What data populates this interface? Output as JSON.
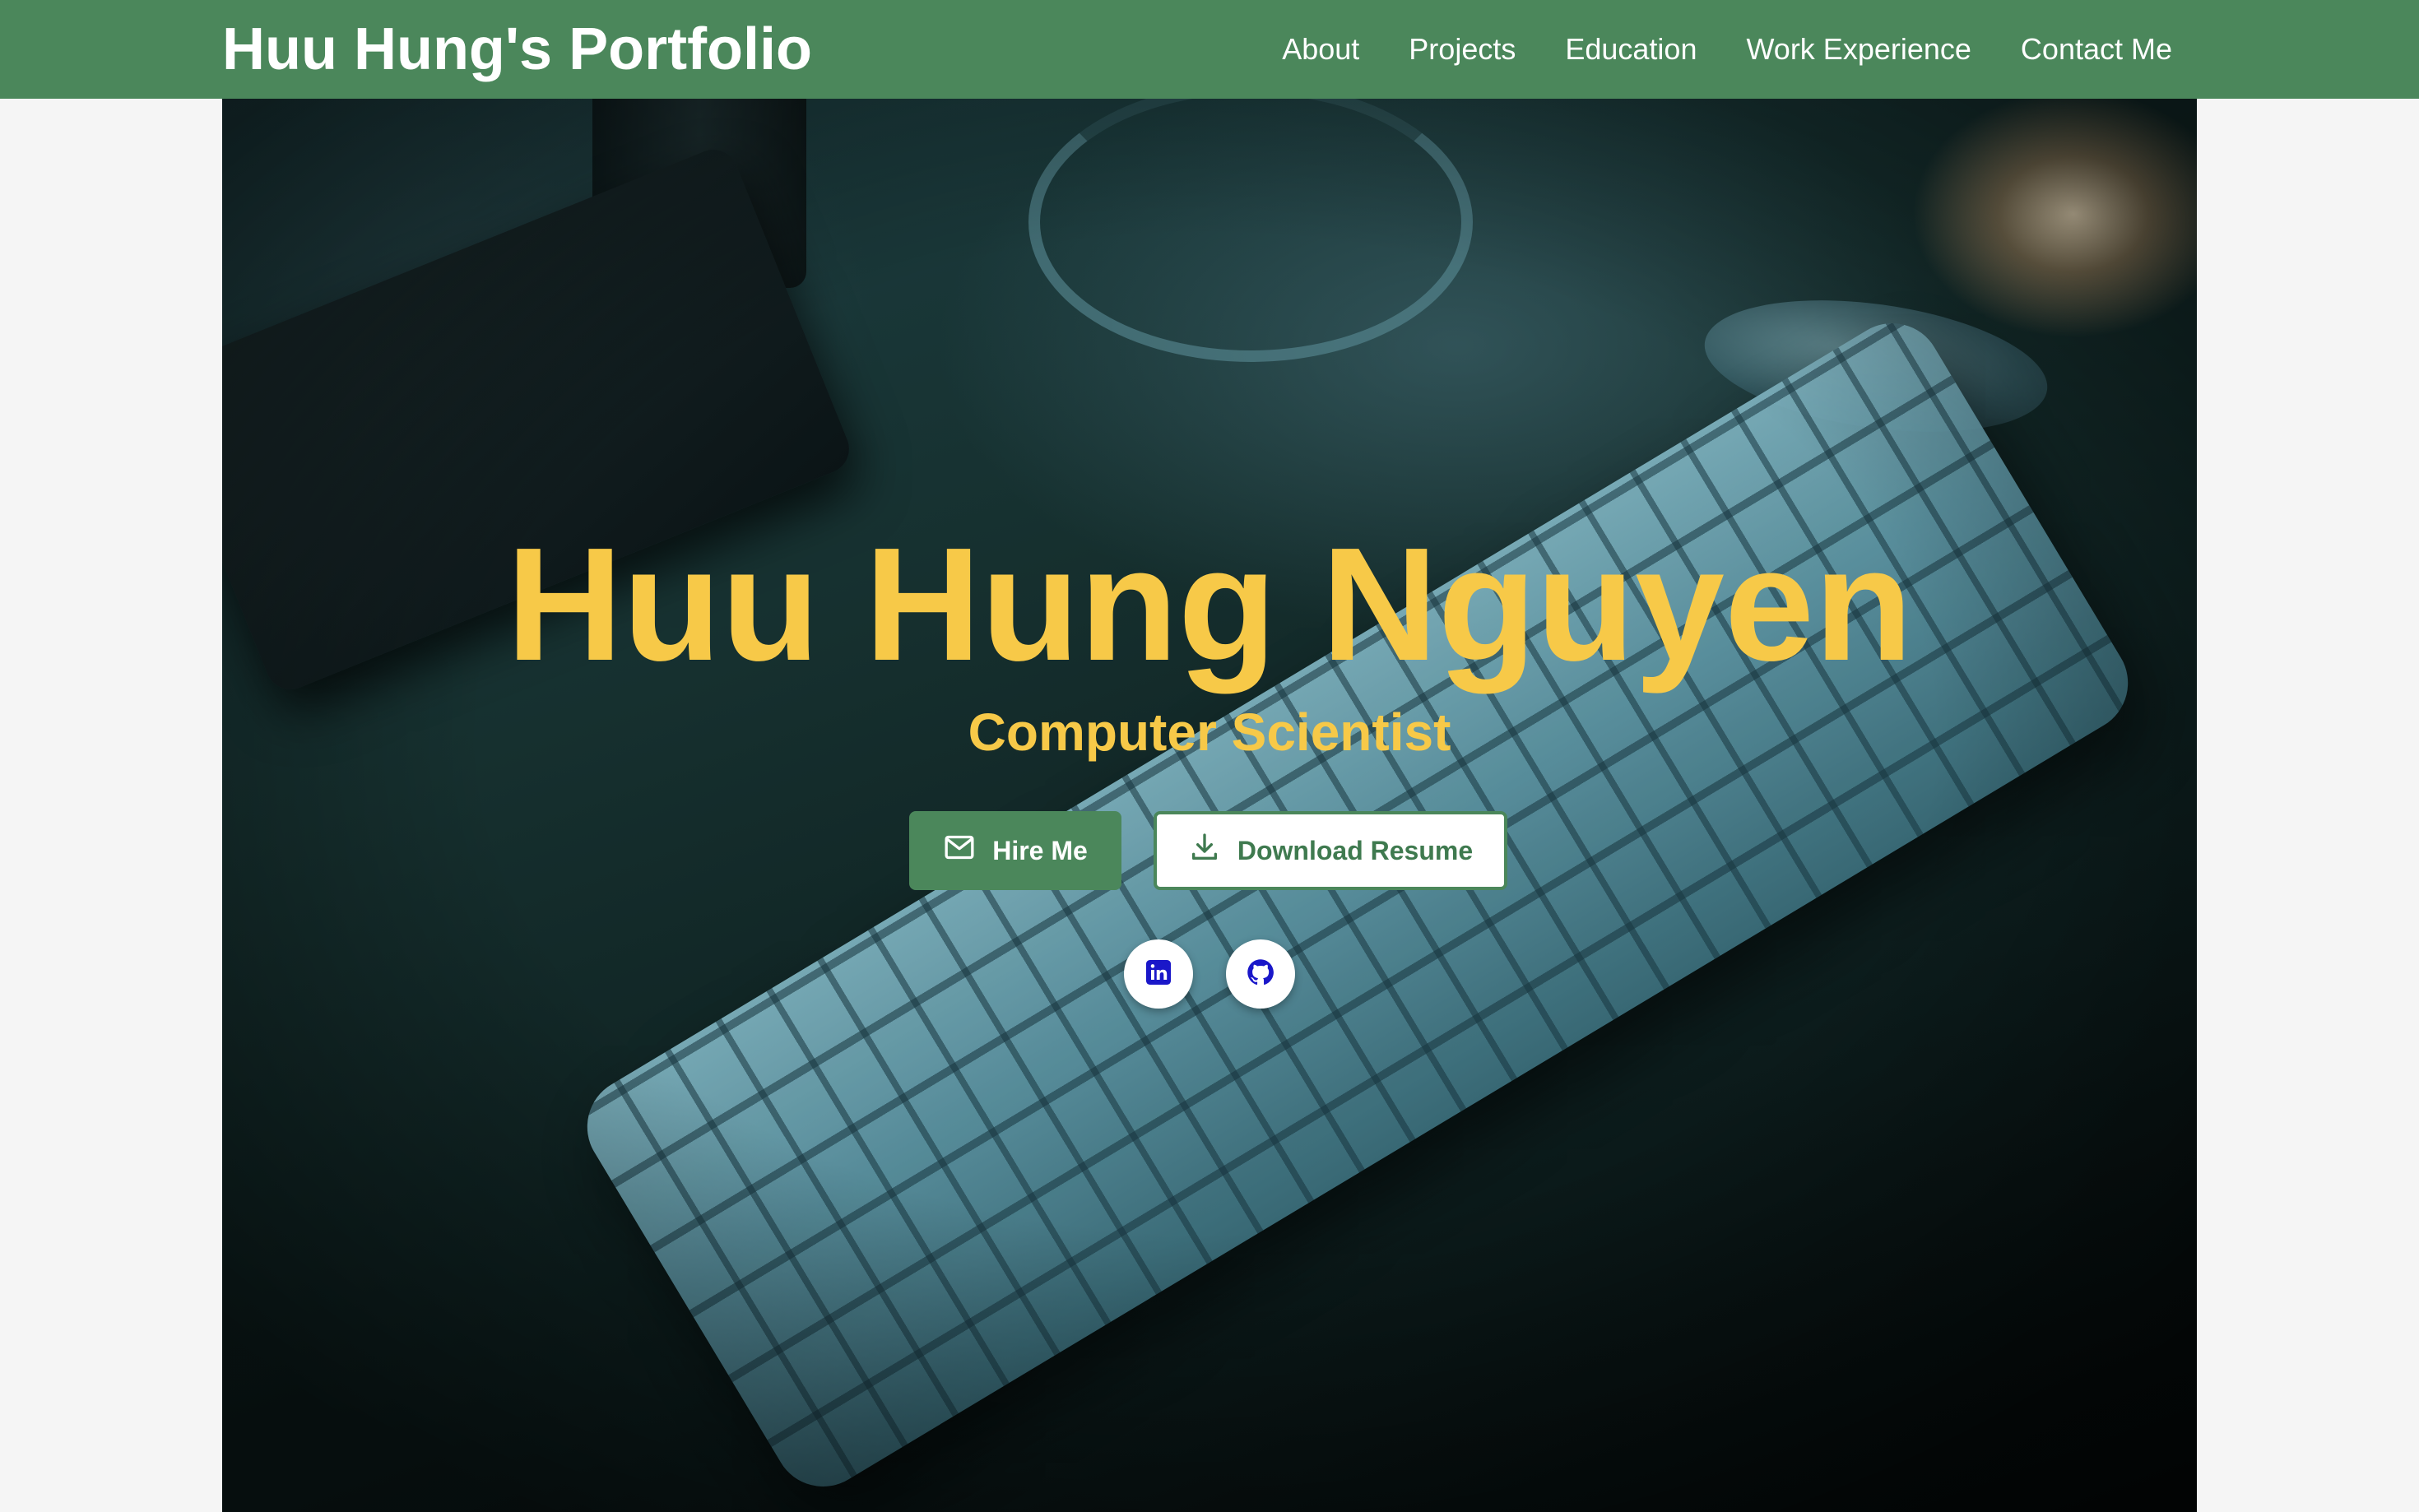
{
  "navbar": {
    "brand": "Huu Hung's Portfolio",
    "links": [
      {
        "label": "About"
      },
      {
        "label": "Projects"
      },
      {
        "label": "Education"
      },
      {
        "label": "Work Experience"
      },
      {
        "label": "Contact Me"
      }
    ]
  },
  "hero": {
    "name": "Huu Hung Nguyen",
    "title": "Computer Scientist",
    "hire_button": {
      "label": "Hire Me",
      "icon": "mail-icon"
    },
    "download_button": {
      "label": "Download Resume",
      "icon": "download-icon"
    },
    "socials": [
      {
        "icon": "linkedin-icon"
      },
      {
        "icon": "github-icon"
      }
    ]
  },
  "colors": {
    "navbar": "#4b875b",
    "accent_text": "#f7c948",
    "button_primary": "#4b875b",
    "social_icon": "#1a17c9",
    "page_background": "#f5f5f5"
  }
}
